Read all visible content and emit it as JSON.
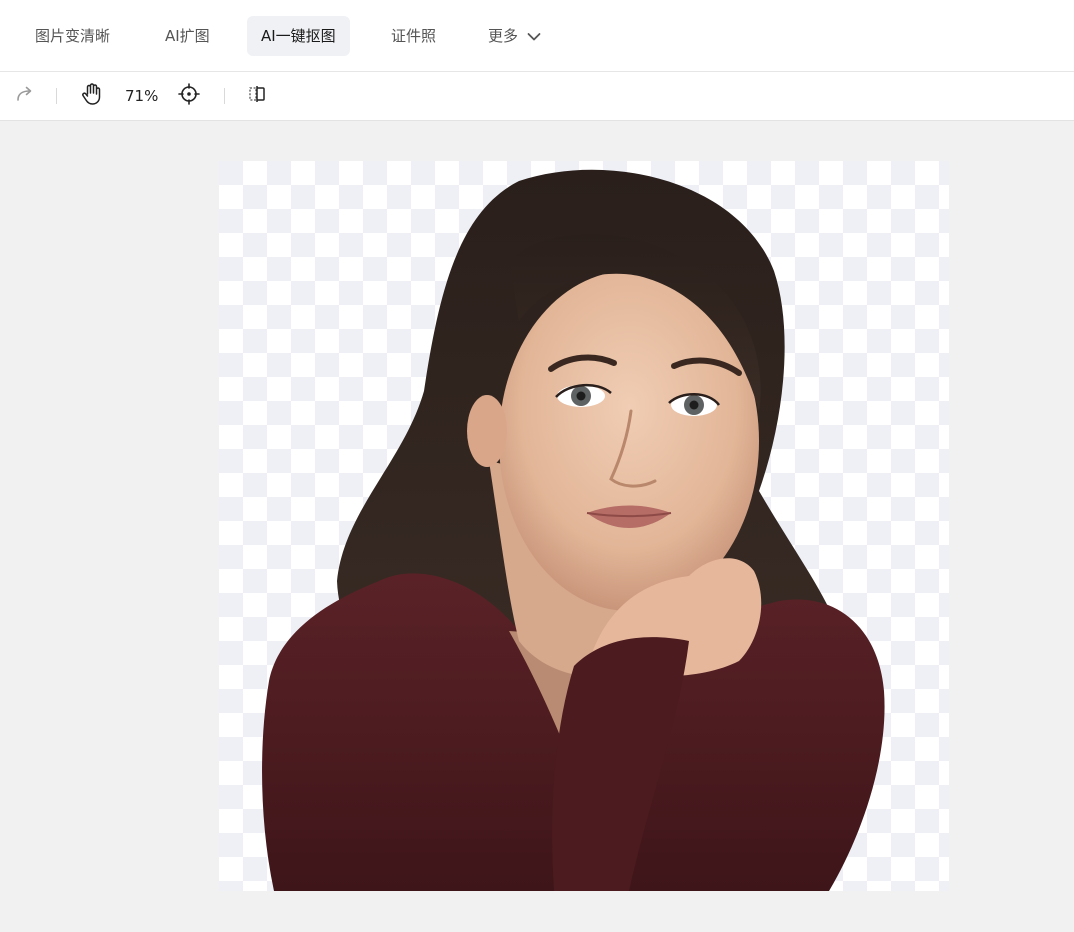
{
  "nav": {
    "tabs": [
      {
        "label": "图片变清晰"
      },
      {
        "label": "AI扩图"
      },
      {
        "label": "AI一键抠图",
        "active": true
      },
      {
        "label": "证件照"
      },
      {
        "label": "更多"
      }
    ]
  },
  "toolbar": {
    "icons": [
      "redo-icon",
      "hand-pan-icon",
      "crosshair-center-icon",
      "compare-split-icon"
    ],
    "zoom_label": "71%"
  },
  "canvas": {
    "image_description": "Cut-out portrait on a transparent checkerboard background",
    "colors": {
      "checker_light": "#ffffff",
      "checker_dark": "#eef0f6",
      "hair": "#2b201c",
      "skin": "#e7bfa3",
      "sweater": "#4d1c20"
    }
  }
}
